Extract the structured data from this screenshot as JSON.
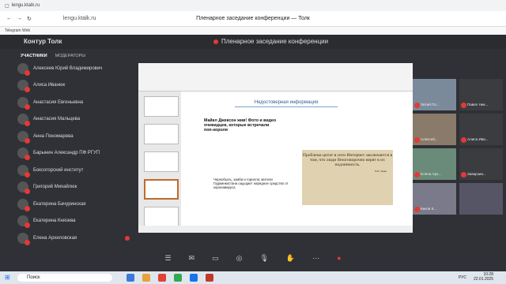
{
  "browser": {
    "tab_label": "lengu.ktalk.ru",
    "url": "lengu.ktalk.ru",
    "title": "Пленарное заседание конференции — Толк",
    "bookmark": "Telegram Web"
  },
  "app": {
    "brand": "Контур Толк",
    "meeting_title": "Пленарное заседание конференции"
  },
  "sidebar": {
    "tabs": [
      "УЧАСТНИКИ",
      "МОДЕРАТОРЫ"
    ],
    "participants": [
      "Алексеев Юрий Владимирович",
      "Алиса Иванюк",
      "Анастасия Евгеньевна",
      "Анастасия Мальцева",
      "Анна Пономарева",
      "Барынин Александр ПФ РГУП",
      "Боксогорский институт",
      "Григорий Михайлюк",
      "Екатерина Бачуринская",
      "Екатерина Князева",
      "Елена Архиловская"
    ]
  },
  "slide": {
    "banner": "Недостоверная информация",
    "heading": "Майкл Джексон жив! Фото и видео очевидцев, которые встречали поп-короля",
    "chernobyl": "Чернобыль, зомби и горилла: жители Гаджинкистана ощущает нарядное средство от коронавируса",
    "quote": "Проблема цитат в сети Интернет заключается в том, что люди безоговорочно верят в их подлинность.",
    "quote_author": "В.И. Ленин"
  },
  "videos": [
    {
      "name": "Литий По..."
    },
    {
      "name": "Павел Ник..."
    },
    {
      "name": "Алексей..."
    },
    {
      "name": "Алиса Ива..."
    },
    {
      "name": "Елена Арх..."
    },
    {
      "name": "Заварзин..."
    },
    {
      "name": "Киков К..."
    },
    {
      "name": ""
    }
  ],
  "taskbar": {
    "search_placeholder": "Поиск",
    "lang": "РУС",
    "time": "10:28",
    "date": "22.01.2025"
  }
}
